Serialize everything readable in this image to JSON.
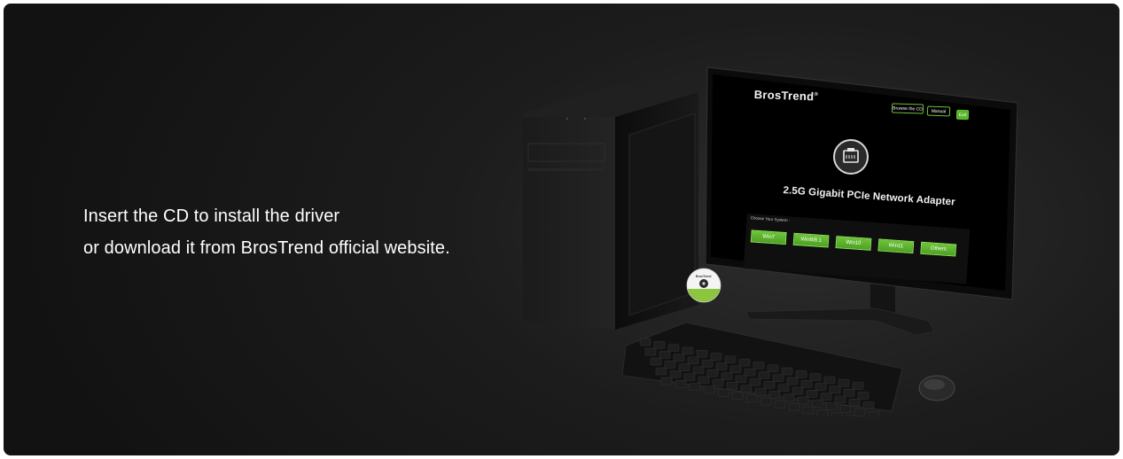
{
  "caption": {
    "line1": "Insert the CD to install the driver",
    "line2": "or download it from BrosTrend official website."
  },
  "screen": {
    "brand": "BrosTrend",
    "brand_mark": "®",
    "buttons": {
      "browse": "Browse the CD",
      "manual": "Manual",
      "exit": "Exit"
    },
    "product_title": "2.5G Gigabit PCIe Network Adapter",
    "choose_label": "Choose Your System :",
    "os_options": [
      "Win7",
      "Win8/8.1",
      "Win10",
      "Win11",
      "Others"
    ],
    "product_icon": "ethernet-port-icon"
  },
  "cd": {
    "label": "BrosTrend"
  },
  "colors": {
    "accent_green": "#57b42a",
    "background": "#1c1c1c",
    "text": "#ffffff"
  }
}
